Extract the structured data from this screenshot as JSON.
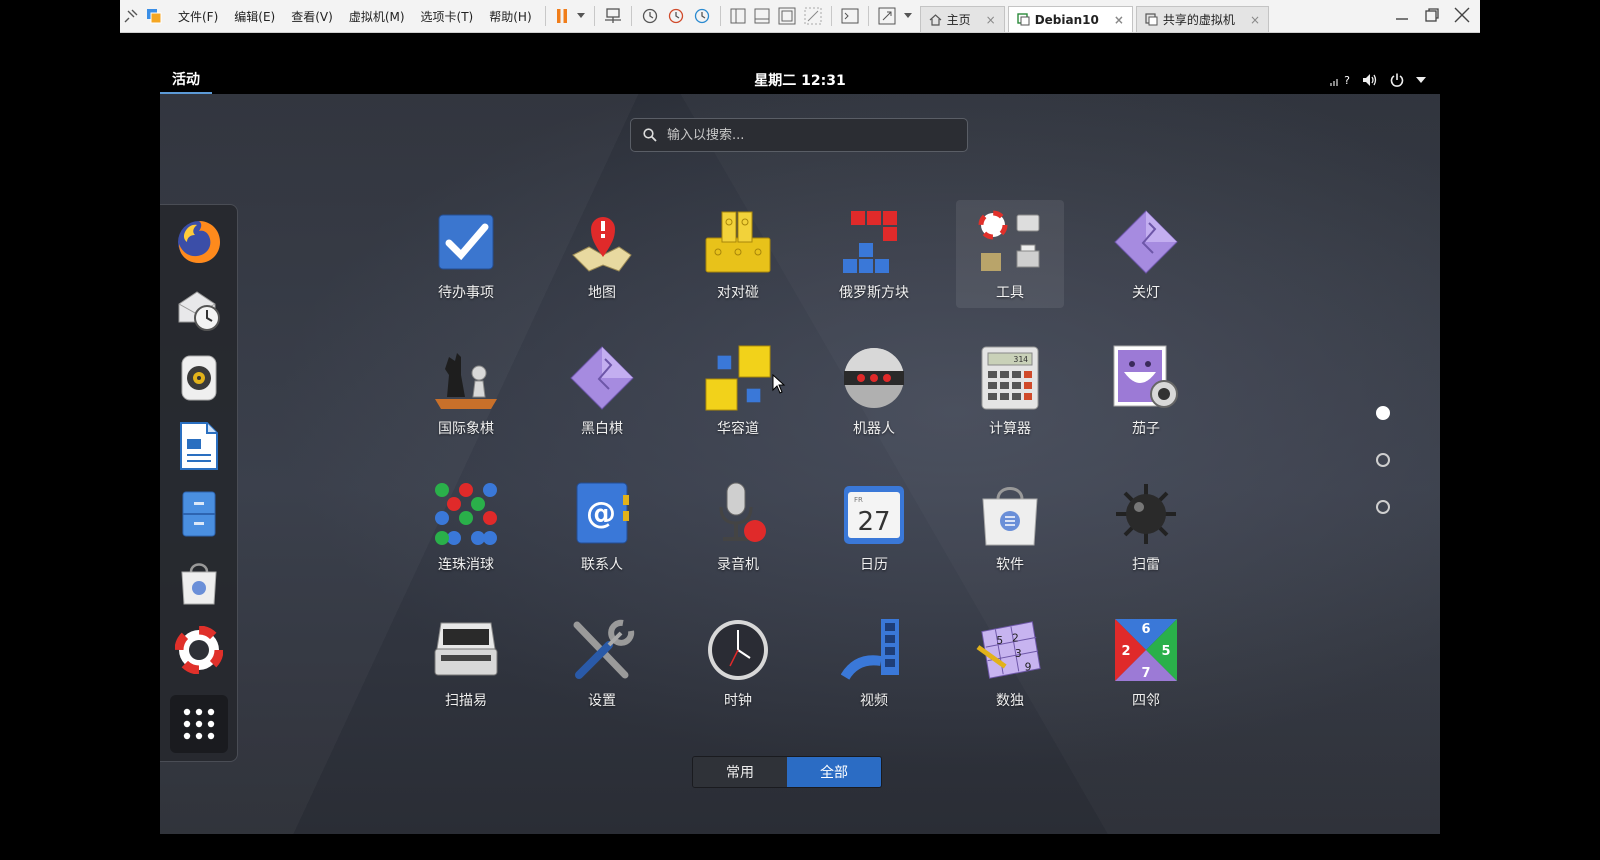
{
  "vm": {
    "menu": [
      "文件(F)",
      "编辑(E)",
      "查看(V)",
      "虚拟机(M)",
      "选项卡(T)",
      "帮助(H)"
    ],
    "tabs": [
      {
        "label": "主页",
        "icon": "home-icon",
        "active": false
      },
      {
        "label": "Debian10",
        "icon": "vm-icon",
        "active": true
      },
      {
        "label": "共享的虚拟机",
        "icon": "shared-vm-icon",
        "active": false
      }
    ],
    "tab_close": "×"
  },
  "topbar": {
    "activities": "活动",
    "clock": "星期二 12:31",
    "tray_help": "?"
  },
  "search": {
    "placeholder": "输入以搜索..."
  },
  "dash": {
    "items": [
      "firefox",
      "evolution",
      "rhythmbox",
      "libreoffice-writer",
      "files",
      "software",
      "help",
      "show-applications"
    ]
  },
  "apps": [
    {
      "label": "待办事项",
      "icon": "todo-icon"
    },
    {
      "label": "地图",
      "icon": "maps-icon"
    },
    {
      "label": "对对碰",
      "icon": "swell-foop-icon"
    },
    {
      "label": "俄罗斯方块",
      "icon": "quadrapassel-icon"
    },
    {
      "label": "工具",
      "icon": "utilities-folder-icon"
    },
    {
      "label": "关灯",
      "icon": "lights-off-icon"
    },
    {
      "label": "国际象棋",
      "icon": "chess-icon"
    },
    {
      "label": "黑白棋",
      "icon": "iagno-icon"
    },
    {
      "label": "华容道",
      "icon": "klotski-icon"
    },
    {
      "label": "机器人",
      "icon": "robots-icon"
    },
    {
      "label": "计算器",
      "icon": "calculator-icon"
    },
    {
      "label": "茄子",
      "icon": "cheese-icon"
    },
    {
      "label": "连珠消球",
      "icon": "five-or-more-icon"
    },
    {
      "label": "联系人",
      "icon": "contacts-icon"
    },
    {
      "label": "录音机",
      "icon": "sound-recorder-icon"
    },
    {
      "label": "日历",
      "icon": "calendar-icon"
    },
    {
      "label": "软件",
      "icon": "software-icon"
    },
    {
      "label": "扫雷",
      "icon": "mines-icon"
    },
    {
      "label": "扫描易",
      "icon": "scanner-icon"
    },
    {
      "label": "设置",
      "icon": "settings-icon"
    },
    {
      "label": "时钟",
      "icon": "clocks-icon"
    },
    {
      "label": "视频",
      "icon": "videos-icon"
    },
    {
      "label": "数独",
      "icon": "sudoku-icon"
    },
    {
      "label": "四邻",
      "icon": "tetravex-icon"
    }
  ],
  "calendar_day": "FR",
  "calendar_date": "27",
  "calc_display": "314",
  "sudoku_digits": [
    "5",
    "2",
    "3",
    "9"
  ],
  "tetravex_digits": [
    "6",
    "2",
    "5",
    "7"
  ],
  "pages": {
    "count": 3,
    "current": 1
  },
  "view_toggle": {
    "frequent": "常用",
    "all": "全部",
    "selected": "all"
  },
  "colors": {
    "accent": "#2b6cc4",
    "active_indicator": "#5c9ad6"
  }
}
